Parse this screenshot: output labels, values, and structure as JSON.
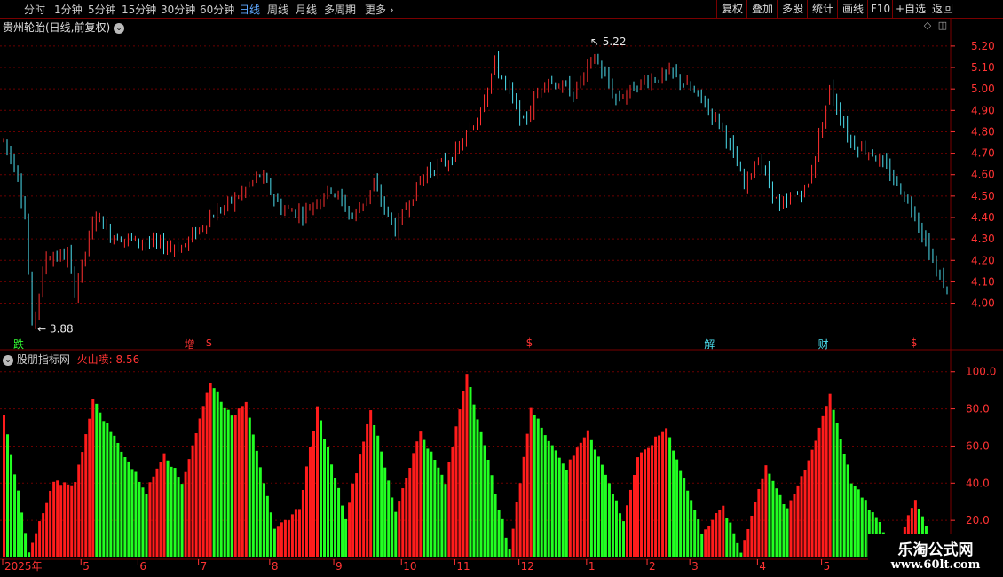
{
  "toolbar": {
    "periods": [
      "分时",
      "1分钟",
      "5分钟",
      "15分钟",
      "30分钟",
      "60分钟",
      "日线",
      "周线",
      "月线",
      "多周期",
      "更多"
    ],
    "active_index": 6,
    "more_arrow": "›",
    "right_buttons": [
      "复权",
      "叠加",
      "多股",
      "统计",
      "画线",
      "F10",
      "+自选",
      "返回"
    ]
  },
  "main_panel": {
    "title": "贵州轮胎(日线,前复权)",
    "dropdown_icon": "chevron-down-icon",
    "window_icons": [
      "diamond-icon",
      "window-restore-icon"
    ]
  },
  "indicator_panel": {
    "title": "股朋指标网",
    "value_label": "火山喷:",
    "value": "8.56",
    "collapse_icon": "chevron-down-icon"
  },
  "colors": {
    "up": "#ff3030",
    "down": "#4de0f0",
    "bar_up": "#ff1c1c",
    "bar_down": "#22ff22",
    "grid": "#6b0000",
    "axis_text": "#ff3333",
    "border": "#7a0000",
    "active_tab": "#5fa8ff"
  },
  "signals": [
    {
      "text": "跌",
      "index": 4,
      "color": "#33ff33"
    },
    {
      "text": "增",
      "index": 52,
      "color": "#ff3333"
    },
    {
      "text": "$",
      "index": 58,
      "color": "#ff3333"
    },
    {
      "text": "$",
      "index": 148,
      "color": "#ff3333"
    },
    {
      "text": "解",
      "index": 198,
      "color": "#4de0f0"
    },
    {
      "text": "财",
      "index": 230,
      "color": "#4de0f0"
    },
    {
      "text": "$",
      "index": 256,
      "color": "#ff3333"
    }
  ],
  "watermark": {
    "line1": "乐淘公式网",
    "line2": "www.60lt.com"
  },
  "chart_data": [
    {
      "type": "candlestick",
      "title": "贵州轮胎(日线,前复权)",
      "y_ticks": [
        4.0,
        4.1,
        4.2,
        4.3,
        4.4,
        4.5,
        4.6,
        4.7,
        4.8,
        4.9,
        5.0,
        5.1,
        5.2
      ],
      "ylim": [
        3.82,
        5.27
      ],
      "grid": true,
      "annotations": [
        {
          "text": "3.88",
          "label": "low"
        },
        {
          "text": "5.22",
          "label": "high"
        }
      ],
      "anchors": [
        [
          0,
          4.76
        ],
        [
          4,
          4.6
        ],
        [
          6,
          4.4
        ],
        [
          8,
          3.88
        ],
        [
          12,
          4.22
        ],
        [
          18,
          4.22
        ],
        [
          20,
          4.06
        ],
        [
          26,
          4.42
        ],
        [
          30,
          4.32
        ],
        [
          40,
          4.28
        ],
        [
          50,
          4.26
        ],
        [
          58,
          4.4
        ],
        [
          66,
          4.5
        ],
        [
          72,
          4.6
        ],
        [
          78,
          4.44
        ],
        [
          84,
          4.42
        ],
        [
          92,
          4.54
        ],
        [
          98,
          4.4
        ],
        [
          104,
          4.55
        ],
        [
          110,
          4.34
        ],
        [
          114,
          4.48
        ],
        [
          118,
          4.6
        ],
        [
          126,
          4.68
        ],
        [
          132,
          4.82
        ],
        [
          138,
          5.12
        ],
        [
          146,
          4.84
        ],
        [
          152,
          5.05
        ],
        [
          160,
          4.98
        ],
        [
          166,
          5.15
        ],
        [
          172,
          4.95
        ],
        [
          180,
          5.04
        ],
        [
          188,
          5.07
        ],
        [
          196,
          4.95
        ],
        [
          202,
          4.82
        ],
        [
          208,
          4.55
        ],
        [
          212,
          4.68
        ],
        [
          218,
          4.44
        ],
        [
          226,
          4.55
        ],
        [
          232,
          5.0
        ],
        [
          238,
          4.75
        ],
        [
          244,
          4.7
        ],
        [
          250,
          4.58
        ],
        [
          256,
          4.42
        ],
        [
          262,
          4.15
        ],
        [
          266,
          4.02
        ]
      ],
      "candle_count": 266
    },
    {
      "type": "bar",
      "title": "股朋指标网",
      "series_label": "火山喷",
      "last_value": 8.56,
      "y_ticks": [
        20.0,
        40.0,
        60.0,
        80.0,
        100.0
      ],
      "ylim": [
        0,
        108
      ],
      "grid": true,
      "x_axis_labels": [
        {
          "text": "2025年",
          "index": 0
        },
        {
          "text": "5",
          "index": 22
        },
        {
          "text": "6",
          "index": 38
        },
        {
          "text": "7",
          "index": 55
        },
        {
          "text": "8",
          "index": 75
        },
        {
          "text": "9",
          "index": 93
        },
        {
          "text": "10",
          "index": 112
        },
        {
          "text": "11",
          "index": 127
        },
        {
          "text": "12",
          "index": 145
        },
        {
          "text": "1",
          "index": 164
        },
        {
          "text": "2",
          "index": 181
        },
        {
          "text": "3",
          "index": 193
        },
        {
          "text": "4",
          "index": 212
        },
        {
          "text": "5",
          "index": 230
        }
      ],
      "peaks": [
        [
          0,
          78
        ],
        [
          7,
          2
        ],
        [
          14,
          40
        ],
        [
          20,
          40
        ],
        [
          25,
          85
        ],
        [
          33,
          58
        ],
        [
          40,
          35
        ],
        [
          45,
          57
        ],
        [
          50,
          40
        ],
        [
          58,
          95
        ],
        [
          64,
          75
        ],
        [
          68,
          85
        ],
        [
          76,
          14
        ],
        [
          83,
          27
        ],
        [
          88,
          80
        ],
        [
          96,
          22
        ],
        [
          103,
          80
        ],
        [
          110,
          25
        ],
        [
          117,
          68
        ],
        [
          124,
          40
        ],
        [
          130,
          100
        ],
        [
          142,
          3
        ],
        [
          148,
          80
        ],
        [
          158,
          48
        ],
        [
          164,
          69
        ],
        [
          174,
          20
        ],
        [
          178,
          53
        ],
        [
          186,
          70
        ],
        [
          196,
          14
        ],
        [
          202,
          27
        ],
        [
          207,
          3
        ],
        [
          214,
          50
        ],
        [
          220,
          25
        ],
        [
          226,
          52
        ],
        [
          232,
          88
        ],
        [
          238,
          41
        ],
        [
          246,
          18
        ],
        [
          250,
          3
        ],
        [
          256,
          32
        ],
        [
          262,
          4
        ],
        [
          266,
          8.56
        ]
      ],
      "bar_count": 266
    }
  ]
}
